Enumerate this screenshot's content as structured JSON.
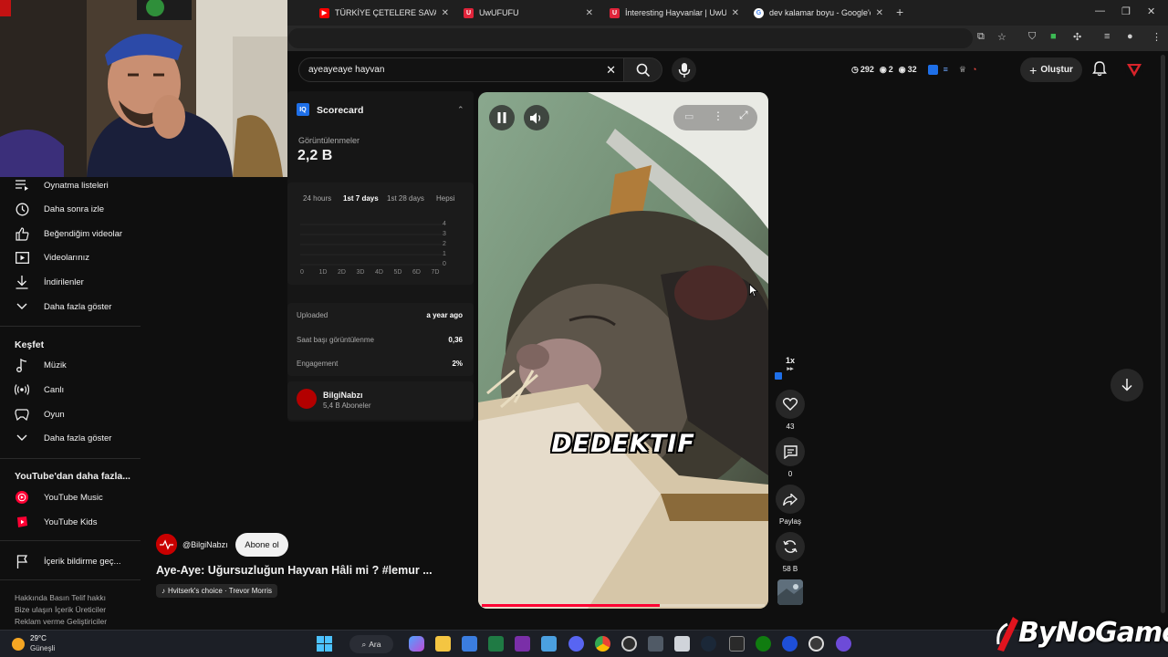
{
  "browser": {
    "tabs": [
      {
        "title": "TÜRKİYE ÇETELERE SAVAŞ AÇTI",
        "favicon": "youtube-icon"
      },
      {
        "title": "UwUFUFU",
        "favicon": "uwufufu-icon"
      },
      {
        "title": "İnteresting Hayvanlar | UwUFUFU",
        "favicon": "uwufufu-icon"
      },
      {
        "title": "dev kalamar boyu - Google'da Ara",
        "favicon": "google-icon"
      }
    ]
  },
  "header": {
    "search_value": "ayeayeaye hayvan",
    "stats": {
      "watched": "292",
      "views": "2",
      "viewers": "32"
    },
    "create_label": "Oluştur"
  },
  "sidebar": {
    "items": [
      {
        "label": "Oynatma listeleri",
        "icon": "playlist-icon"
      },
      {
        "label": "Daha sonra izle",
        "icon": "clock-icon"
      },
      {
        "label": "Beğendiğim videolar",
        "icon": "thumbs-up-icon"
      },
      {
        "label": "Videolarınız",
        "icon": "video-icon"
      },
      {
        "label": "İndirilenler",
        "icon": "download-icon"
      },
      {
        "label": "Daha fazla göster",
        "icon": "chevron-down-icon"
      }
    ],
    "explore_title": "Keşfet",
    "explore": [
      {
        "label": "Müzik",
        "icon": "music-icon"
      },
      {
        "label": "Canlı",
        "icon": "live-icon"
      },
      {
        "label": "Oyun",
        "icon": "gamepad-icon"
      },
      {
        "label": "Daha fazla göster",
        "icon": "chevron-down-icon"
      }
    ],
    "more_title": "YouTube'dan daha fazla...",
    "more": [
      {
        "label": "YouTube Music",
        "icon": "youtube-music-icon"
      },
      {
        "label": "YouTube Kids",
        "icon": "youtube-kids-icon"
      }
    ],
    "report": {
      "label": "İçerik bildirme geç...",
      "icon": "flag-icon"
    },
    "footer": [
      "Hakkında  Basın  Telif hakkı",
      "Bize ulaşın  İçerik Üreticiler",
      "Reklam verme  Geliştiriciler"
    ]
  },
  "scorecard": {
    "title": "Scorecard",
    "views_label": "Görüntülenmeler",
    "views_value": "2,2 B",
    "tabs": [
      "24 hours",
      "1st 7 days",
      "1st 28 days",
      "Hepsi"
    ],
    "active_tab": "1st 7 days",
    "y_ticks": [
      "4",
      "3",
      "2",
      "1",
      "0"
    ],
    "x_ticks": [
      "0",
      "1D",
      "2D",
      "3D",
      "4D",
      "5D",
      "6D",
      "7D"
    ],
    "rows": [
      {
        "label": "Uploaded",
        "value": "a year ago"
      },
      {
        "label": "Saat başı görüntülenme",
        "value": "0,36"
      },
      {
        "label": "Engagement",
        "value": "2%"
      }
    ],
    "channel_name": "BilgiNabzı",
    "channel_subs": "5,4 B Aboneler"
  },
  "video": {
    "caption": "DEDEKTIF",
    "progress": 0.63
  },
  "actions": {
    "speed": "1x",
    "likes": "43",
    "comments": "0",
    "share_label": "Paylaş",
    "remix_count": "58 B"
  },
  "short": {
    "channel_handle": "@BilgiNabzı",
    "subscribe_label": "Abone ol",
    "title": "Aye-Aye: Uğursuzluğun Hayvan Hâli mi ? #lemur ...",
    "music": "Hvitserk's choice · Trevor Morris"
  },
  "taskbar": {
    "temp": "29°C",
    "weather": "Güneşli",
    "search_label": "Ara"
  },
  "watermark": "ByNoGame",
  "colors": {
    "accent": "#ff0033",
    "background": "#0f0f0f",
    "scorecard_blue": "#1e6fe8"
  }
}
